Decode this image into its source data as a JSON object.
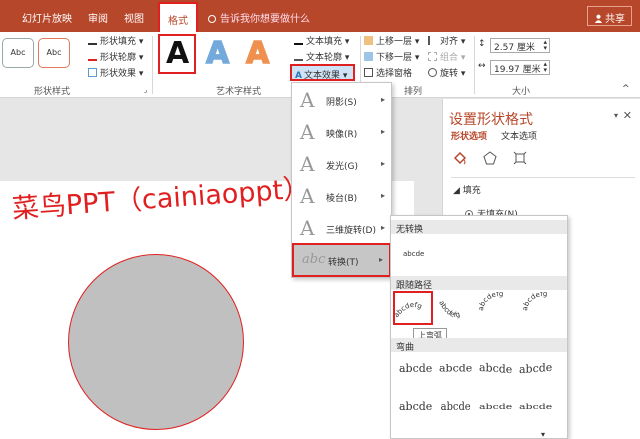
{
  "tabs": [
    "幻灯片放映",
    "审阅",
    "视图",
    "格式"
  ],
  "tell_me": "告诉我你想要做什么",
  "share": "共享",
  "ribbon": {
    "shape_styles": {
      "samples": [
        "Abc",
        "Abc"
      ],
      "fill": "形状填充",
      "outline": "形状轮廓",
      "effects": "形状效果",
      "label": "形状样式"
    },
    "wordart": {
      "letters": [
        "A",
        "A",
        "A"
      ],
      "letter_colors": [
        "#111111",
        "#5b9bd5",
        "#ed7d31"
      ],
      "text_fill": "文本填充",
      "text_outline": "文本轮廓",
      "text_effects": "文本效果",
      "label": "艺术字样式"
    },
    "arrange": {
      "bring_forward": "上移一层",
      "send_backward": "下移一层",
      "selection_pane": "选择窗格",
      "align": "对齐",
      "group": "组合",
      "rotate": "旋转",
      "label": "排列"
    },
    "size": {
      "height": "2.57 厘米",
      "width": "19.97 厘米",
      "label": "大小"
    }
  },
  "slide": {
    "title": "菜鸟PPT（cainiaoppt）"
  },
  "pane": {
    "title": "设置形状格式",
    "tab_shape": "形状选项",
    "tab_text": "文本选项",
    "fill_header": "填充",
    "no_fill": "无填充(N)"
  },
  "effects_menu": [
    {
      "label": "阴影(S)",
      "glyph": "A"
    },
    {
      "label": "映像(R)",
      "glyph": "A"
    },
    {
      "label": "发光(G)",
      "glyph": "A"
    },
    {
      "label": "棱台(B)",
      "glyph": "A"
    },
    {
      "label": "三维旋转(D)",
      "glyph": "A"
    },
    {
      "label": "转换(T)",
      "glyph": "abc"
    }
  ],
  "transform": {
    "no_transform": "无转换",
    "sample": "abcde",
    "follow_path": "跟随路径",
    "arc_letters": "abcdefg",
    "tooltip": "上弯弧",
    "warp": "弯曲",
    "warp_row1": [
      "abcde",
      "abcde",
      "abcde",
      "abcde"
    ],
    "warp_row2": [
      "abcde",
      "abcde",
      "abcde",
      "abcde"
    ]
  }
}
